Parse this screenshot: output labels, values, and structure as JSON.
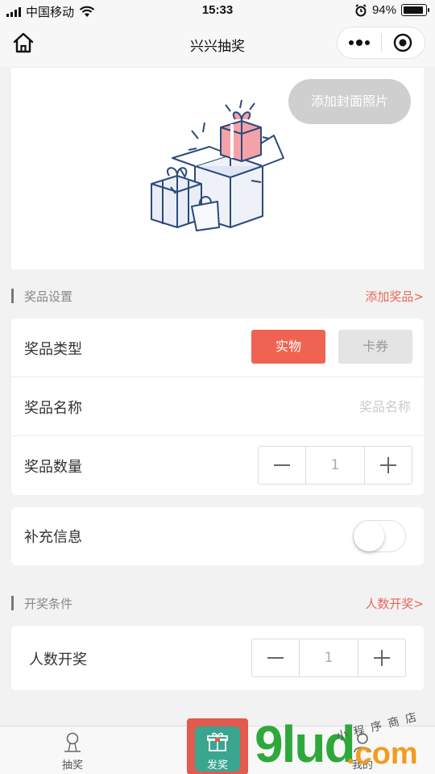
{
  "status_bar": {
    "carrier": "中国移动",
    "time": "15:33",
    "battery": "94%",
    "battery_level": 0.94
  },
  "nav": {
    "title": "兴兴抽奖"
  },
  "cover": {
    "add_photo_label": "添加封面照片"
  },
  "prize_section": {
    "title": "奖品设置",
    "add_link": "添加奖品>",
    "type_label": "奖品类型",
    "type_options": [
      "实物",
      "卡券"
    ],
    "name_label": "奖品名称",
    "name_placeholder": "奖品名称",
    "name_value": "",
    "qty_label": "奖品数量",
    "qty_value": "1"
  },
  "extra": {
    "label": "补充信息",
    "enabled": false
  },
  "draw_section": {
    "title": "开奖条件",
    "link": "人数开奖>",
    "people_label": "人数开奖",
    "people_value": "1"
  },
  "tabs": [
    {
      "label": "抽奖"
    },
    {
      "label": "发奖"
    },
    {
      "label": "我的"
    }
  ],
  "watermark": {
    "big": "9lud",
    "dotcom": ".com",
    "small": "小程序商店"
  },
  "colors": {
    "accent": "#ef6353",
    "link": "#e8685c"
  }
}
